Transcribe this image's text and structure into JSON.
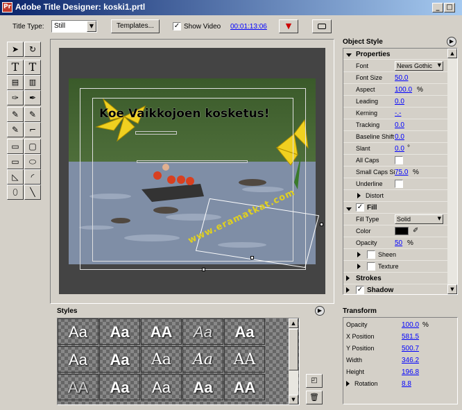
{
  "window": {
    "title": "Adobe Title Designer: koski1.prtl",
    "app_icon": "Pr"
  },
  "toolbar": {
    "title_type_label": "Title Type:",
    "title_type_value": "Still",
    "templates_label": "Templates...",
    "show_video_label": "Show Video",
    "show_video_checked": true,
    "timecode": "00:01:13:06"
  },
  "canvas": {
    "title_text": "Koe Vaikkojoen kosketus!",
    "watermark": "www.eramatkat.com"
  },
  "object_style": {
    "header": "Object Style",
    "properties_label": "Properties",
    "font_label": "Font",
    "font_value": "News Gothic",
    "font_size_label": "Font Size",
    "font_size_value": "50.0",
    "aspect_label": "Aspect",
    "aspect_value": "100.0",
    "aspect_unit": "%",
    "leading_label": "Leading",
    "leading_value": "0.0",
    "kerning_label": "Kerning",
    "kerning_value": "-.-",
    "tracking_label": "Tracking",
    "tracking_value": "0.0",
    "baseline_label": "Baseline Shift",
    "baseline_value": "0.0",
    "slant_label": "Slant",
    "slant_value": "0.0",
    "slant_unit": "°",
    "allcaps_label": "All Caps",
    "smallcaps_label": "Small Caps Size",
    "smallcaps_value": "75.0",
    "smallcaps_unit": "%",
    "underline_label": "Underline",
    "distort_label": "Distort",
    "fill_label": "Fill",
    "fill_type_label": "Fill Type",
    "fill_type_value": "Solid",
    "color_label": "Color",
    "opacity_label": "Opacity",
    "opacity_value": "50",
    "opacity_unit": "%",
    "sheen_label": "Sheen",
    "texture_label": "Texture",
    "strokes_label": "Strokes",
    "shadow_label": "Shadow"
  },
  "styles": {
    "header": "Styles",
    "samples": [
      "Aa",
      "Aa",
      "AA",
      "Aa",
      "Aa",
      "Aa",
      "Aa",
      "Aa",
      "Aa",
      "AA",
      "AA",
      "Aa",
      "Aa",
      "Aa",
      "AA"
    ]
  },
  "transform": {
    "header": "Transform",
    "opacity_label": "Opacity",
    "opacity_value": "100.0",
    "opacity_unit": "%",
    "x_label": "X Position",
    "x_value": "581.5",
    "y_label": "Y Position",
    "y_value": "500.7",
    "width_label": "Width",
    "width_value": "346.2",
    "height_label": "Height",
    "height_value": "196.8",
    "rotation_label": "Rotation",
    "rotation_value": "8.8"
  },
  "colors": {
    "titlebar": "#0a246a",
    "link": "#0000ff",
    "title_text": "#000000",
    "watermark": "#e0d020"
  },
  "icons": [
    "selection-arrow",
    "rotate",
    "type",
    "vertical-type",
    "area-type",
    "vertical-area-type",
    "path-type",
    "vertical-path-type",
    "pen",
    "add-anchor",
    "delete-anchor",
    "convert-anchor",
    "rectangle",
    "rounded-rect",
    "clipped-rect",
    "rounded-corner-rect",
    "wedge",
    "arc",
    "ellipse",
    "line"
  ]
}
